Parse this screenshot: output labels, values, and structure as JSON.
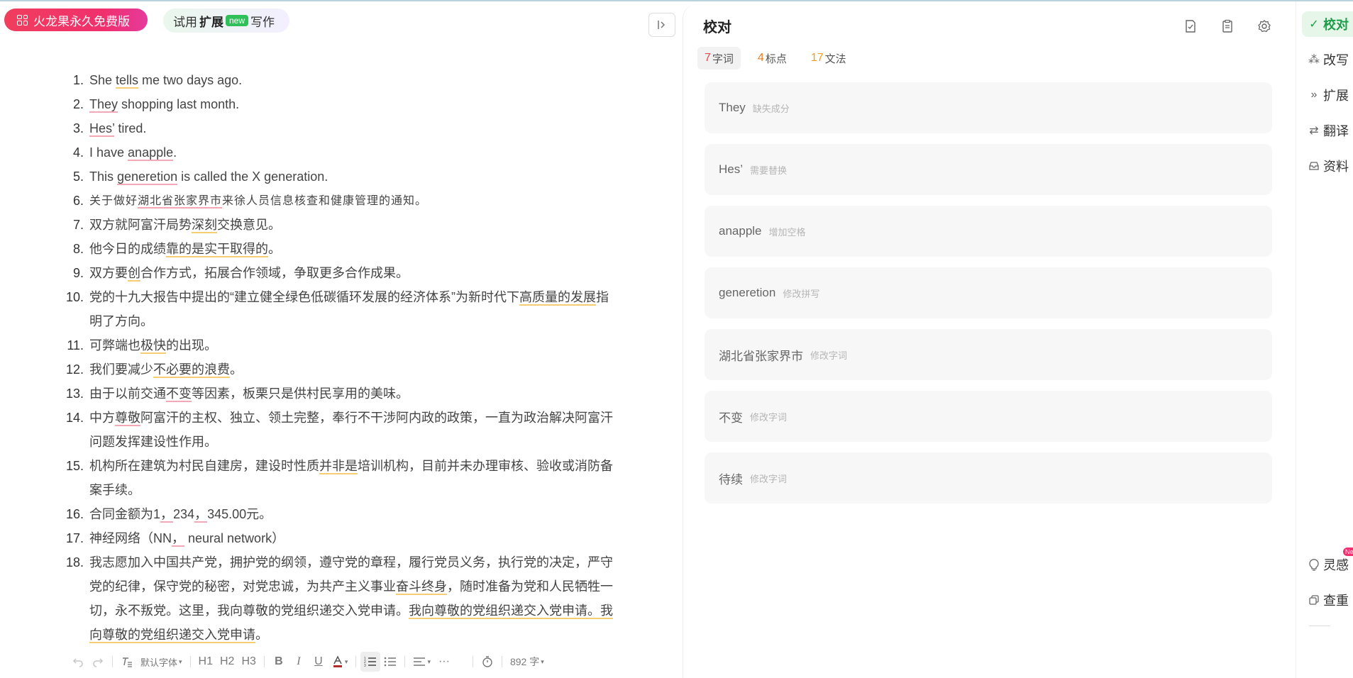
{
  "header": {
    "brand_label": "火龙果永久免费版",
    "try_prefix": "试用",
    "try_bold": "扩展",
    "try_tag": "new",
    "try_suffix": "写作",
    "collapse_icon": "panel-collapse-icon"
  },
  "document": {
    "items": [
      {
        "num": "1.",
        "segments": [
          {
            "t": "She "
          },
          {
            "t": "tells",
            "u": "yel"
          },
          {
            "t": " me two days ago."
          }
        ]
      },
      {
        "num": "2.",
        "segments": [
          {
            "t": "They",
            "u": "red"
          },
          {
            "t": " shopping last month."
          }
        ]
      },
      {
        "num": "3.",
        "segments": [
          {
            "t": "Hes’",
            "u": "red"
          },
          {
            "t": " tired."
          }
        ]
      },
      {
        "num": "4.",
        "segments": [
          {
            "t": "I have "
          },
          {
            "t": "anapple",
            "u": "red"
          },
          {
            "t": "."
          }
        ]
      },
      {
        "num": "5.",
        "segments": [
          {
            "t": "This "
          },
          {
            "t": "generetion",
            "u": "red"
          },
          {
            "t": " is called the X generation."
          }
        ]
      },
      {
        "num": "6.",
        "serif": true,
        "segments": [
          {
            "t": "关于做好"
          },
          {
            "t": "湖北省张家界市",
            "u": "red"
          },
          {
            "t": "来徐人员信息核查和健康管理的通知。"
          }
        ]
      },
      {
        "num": "7.",
        "segments": [
          {
            "t": "双方就阿富汗局势"
          },
          {
            "t": "深刻",
            "u": "yel"
          },
          {
            "t": "交换意见。"
          }
        ]
      },
      {
        "num": "8.",
        "segments": [
          {
            "t": "他今日的成绩"
          },
          {
            "t": "靠的是实干取得的",
            "u": "yel"
          },
          {
            "t": "。"
          }
        ]
      },
      {
        "num": "9.",
        "segments": [
          {
            "t": "双方要"
          },
          {
            "t": "创",
            "u": "yel"
          },
          {
            "t": "合作方式，拓展合作领域，争取更多合作成果。"
          }
        ]
      },
      {
        "num": "10.",
        "segments": [
          {
            "t": "党的十九大报告中提出的“建立健全绿色低碳循环发展的经济体系”为新时代下"
          },
          {
            "t": "高质量的发展",
            "u": "yel"
          },
          {
            "t": "指明了方向。"
          }
        ]
      },
      {
        "num": "11.",
        "segments": [
          {
            "t": "可弊端也"
          },
          {
            "t": "极快",
            "u": "yel"
          },
          {
            "t": "的出现。"
          }
        ]
      },
      {
        "num": "12.",
        "segments": [
          {
            "t": "我们要减少"
          },
          {
            "t": "不必要的浪费",
            "u": "yel"
          },
          {
            "t": "。"
          }
        ]
      },
      {
        "num": "13.",
        "segments": [
          {
            "t": "由于以前交通"
          },
          {
            "t": "不变",
            "u": "red"
          },
          {
            "t": "等因素，板栗只是供村民享用的美味。"
          }
        ]
      },
      {
        "num": "14.",
        "segments": [
          {
            "t": "中方"
          },
          {
            "t": "尊敬",
            "u": "red"
          },
          {
            "t": "阿富汗的主权、独立、领土完整，奉行不干涉阿内政的政策，一直为政治解决阿富汗问题发挥建设性作用。"
          }
        ]
      },
      {
        "num": "15.",
        "segments": [
          {
            "t": "机构所在建筑为村民自建房，建设时性质"
          },
          {
            "t": "并非是",
            "u": "yel"
          },
          {
            "t": "培训机构，目前并未办理审核、验收或消防备案手续。"
          }
        ]
      },
      {
        "num": "16.",
        "segments": [
          {
            "t": "合同金额为1"
          },
          {
            "t": "，",
            "u": "red"
          },
          {
            "t": "234"
          },
          {
            "t": "，",
            "u": "red"
          },
          {
            "t": "345.00元。"
          }
        ]
      },
      {
        "num": "17.",
        "segments": [
          {
            "t": "神经网络（NN"
          },
          {
            "t": "，",
            "u": "red"
          },
          {
            "t": " neural network）"
          }
        ]
      },
      {
        "num": "18.",
        "segments": [
          {
            "t": "我志愿加入中国共产党，拥护党的纲领，遵守党的章程，履行党员义务，执行党的决定，严守党的纪律，保守党的秘密，对党忠诚，为共产主义事业"
          },
          {
            "t": "奋斗终身",
            "u": "yel"
          },
          {
            "t": "，随时准备为党和人民牺牲一切，永不叛党。这里，我向尊敬的党组织递交入党申请。"
          },
          {
            "t": "我向尊敬的党组织递交入党申请。我向尊敬的党组织递交入党申请",
            "u": "yel"
          },
          {
            "t": "。"
          }
        ]
      }
    ]
  },
  "toolbar": {
    "undo_icon": "undo-icon",
    "redo_icon": "redo-icon",
    "clear_format_icon": "clear-format-icon",
    "font_label": "默认字体",
    "h1": "H1",
    "h2": "H2",
    "h3": "H3",
    "bold": "B",
    "italic": "I",
    "underline": "U",
    "word_count": "892 字"
  },
  "panel": {
    "title": "校对",
    "tabs": [
      {
        "count": "7",
        "label": "字词",
        "color": "red"
      },
      {
        "count": "4",
        "label": "标点",
        "color": "orange"
      },
      {
        "count": "17",
        "label": "文法",
        "color": "amber"
      }
    ],
    "cards": [
      {
        "word": "They",
        "reason": "缺失成分"
      },
      {
        "word": "Hes’",
        "reason": "需要替换"
      },
      {
        "word": "anapple",
        "reason": "增加空格"
      },
      {
        "word": "generetion",
        "reason": "修改拼写"
      },
      {
        "word": "湖北省张家界市",
        "reason": "修改字词"
      },
      {
        "word": "不变",
        "reason": "修改字词"
      },
      {
        "word": "待续",
        "reason": "修改字词"
      }
    ]
  },
  "rail": {
    "items": [
      {
        "label": "校对",
        "icon": "check-icon"
      },
      {
        "label": "改写",
        "icon": "sparkle-icon"
      },
      {
        "label": "扩展",
        "icon": "double-chevron-icon"
      },
      {
        "label": "翻译",
        "icon": "swap-arrows-icon"
      },
      {
        "label": "资料",
        "icon": "inbox-icon"
      }
    ],
    "bottom": [
      {
        "label": "灵感",
        "icon": "lightbulb-icon",
        "badge": "New"
      },
      {
        "label": "查重",
        "icon": "copy-check-icon"
      }
    ]
  },
  "colors": {
    "brand": "#f0306e",
    "accent_green": "#1e9d4a",
    "underline_red": "#f4a8b6",
    "underline_yellow": "#f5cd72"
  }
}
